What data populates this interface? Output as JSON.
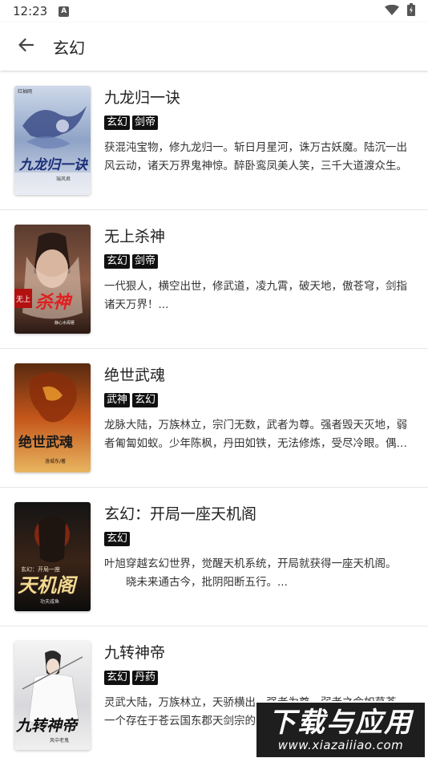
{
  "status_bar": {
    "time": "12:23",
    "notification_letter": "A",
    "icons": [
      "wifi-icon",
      "battery-icon"
    ]
  },
  "app_bar": {
    "back_icon": "arrow-left-icon",
    "title": "玄幻"
  },
  "books": [
    {
      "title": "九龙归一诀",
      "tags": [
        "玄幻",
        "剑帝"
      ],
      "desc_lines": [
        "获混沌宝物，修九龙归一。斩日月星河，诛万古妖魔。陆沉一出",
        "风云动，诸天万界鬼神惊。醉卧鸾凤美人笑，三千大道渡众生。"
      ],
      "cover": {
        "top": "红袖网",
        "title": "九龙归一诀",
        "author": "瑞风君"
      }
    },
    {
      "title": "无上杀神",
      "tags": [
        "玄幻",
        "剑帝"
      ],
      "desc_lines": [
        "一代狠人，横空出世，修武道，凌九霄，破天地，傲苍穹，剑指",
        "诸天万界！..."
      ],
      "cover": {
        "top": "无上",
        "title": "杀神",
        "author": "静心水阁著"
      }
    },
    {
      "title": "绝世武魂",
      "tags": [
        "武神",
        "玄幻"
      ],
      "desc_lines": [
        "龙脉大陆，万族林立，宗门无数，武者为尊。强者毁天灭地，弱",
        "者匍匐如蚁。少年陈枫，丹田如铁，无法修炼，受尽冷眼。偶得..."
      ],
      "cover": {
        "title": "绝世武魂",
        "author": "洛城东/著"
      }
    },
    {
      "title": "玄幻：开局一座天机阁",
      "tags": [
        "玄幻"
      ],
      "desc_lines": [
        "叶旭穿越玄幻世界，觉醒天机系统，开局就获得一座天机阁。",
        "　　晓未来通古今，批阴阳断五行。..."
      ],
      "cover": {
        "top": "玄幻：开局一座",
        "title": "天机阁",
        "author": "功夫咸鱼"
      }
    },
    {
      "title": "九转神帝",
      "tags": [
        "玄幻",
        "丹药"
      ],
      "desc_lines": [
        "灵武大陆，万族林立，天骄横出，强者为尊，弱者之命如草芥。",
        "一个存在于苍云国东郡天剑宗的少年"
      ],
      "cover": {
        "title": "九转神帝",
        "author": "风中老鬼"
      }
    }
  ],
  "watermark": {
    "main": "下载与应用",
    "sub": "www.xiazaiiiao.com"
  }
}
